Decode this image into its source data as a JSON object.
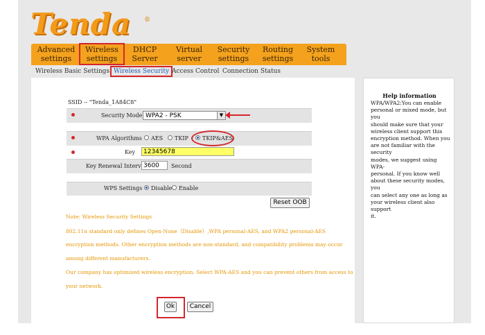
{
  "brand": {
    "logo": "Tenda",
    "mark": "®"
  },
  "nav": [
    {
      "line1": "Advanced",
      "line2": "settings"
    },
    {
      "line1": "Wireless",
      "line2": "settings"
    },
    {
      "line1": "DHCP",
      "line2": "Server"
    },
    {
      "line1": "Virtual",
      "line2": "server"
    },
    {
      "line1": "Security",
      "line2": "settings"
    },
    {
      "line1": "Routing",
      "line2": "settings"
    },
    {
      "line1": "System",
      "line2": "tools"
    }
  ],
  "subnav": [
    "Wireless Basic Settings",
    "Wireless Security",
    "Access Control",
    "Connection Status"
  ],
  "form": {
    "ssid_text": "SSID -- \"Tenda_1A84C8\"",
    "security_mode_label": "Security Mode",
    "security_mode_value": "WPA2 - PSK",
    "wpa_algorithms_label": "WPA Algorithms",
    "alg_aes": "AES",
    "alg_tkip": "TKIP",
    "alg_tkipaes": "TKIP&AES",
    "key_label": "Key",
    "key_value": "12345678",
    "renewal_label": "Key Renewal Interval",
    "renewal_value": "3600",
    "renewal_unit": "Second",
    "wps_label": "WPS Settings",
    "wps_disable": "Disable",
    "wps_enable": "Enable",
    "reset_oob": "Reset OOB",
    "ok": "Ok",
    "cancel": "Cancel"
  },
  "notes": [
    "Note: Wireless Security Settings",
    "802.11n standard only defines Open-None（Disable）,WPA personal-AES, and WPA2 personal-AES",
    "encryption methods. Other encryption methods are non-standard, and compatibility problems may occur",
    "among different manufacturers.",
    "Our company has optimized wireless encryption. Select WPA-AES and you can prevent others from access to",
    "your network."
  ],
  "help": {
    "title": "Help information",
    "lines": [
      "WPA/WPA2:You can enable",
      "personal or mixed mode, but you",
      "should make sure that your",
      "wireless client support this",
      "encryption method. When you",
      "are not familiar with the security",
      "modes, we suggest using WPA-",
      "personal. If you know well",
      "about these security modes, you",
      "can select any one as long as",
      "your wireless client also support",
      "it."
    ]
  },
  "colors": {
    "accent": "#f4a21e",
    "annotation": "#d3262b",
    "note_text": "#e69500",
    "key_highlight": "#ffff66"
  },
  "selections": {
    "algorithm": "TKIP&AES",
    "wps": "Disable"
  }
}
